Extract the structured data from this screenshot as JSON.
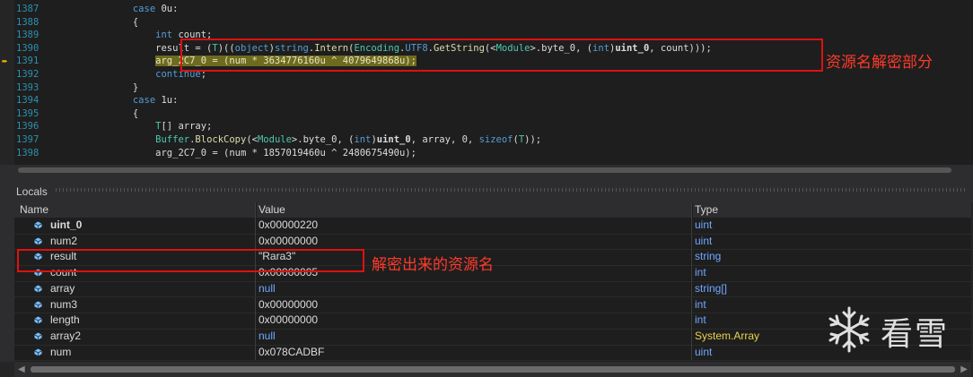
{
  "editor": {
    "lines": [
      {
        "num": "1387",
        "indent": "            ",
        "segments": [
          [
            "kw",
            "case "
          ],
          [
            "",
            "0u:"
          ]
        ]
      },
      {
        "num": "1388",
        "indent": "            ",
        "segments": [
          [
            "",
            "{"
          ]
        ]
      },
      {
        "num": "1389",
        "indent": "                ",
        "segments": [
          [
            "kw",
            "int "
          ],
          [
            "",
            "count;"
          ]
        ]
      },
      {
        "num": "1390",
        "indent": "                ",
        "segments": [
          [
            "",
            "result = ("
          ],
          [
            "ty",
            "T"
          ],
          [
            "",
            ")(("
          ],
          [
            "kw",
            "object"
          ],
          [
            "",
            ")"
          ],
          [
            "kw",
            "string"
          ],
          [
            "",
            "."
          ],
          [
            "mt",
            "Intern"
          ],
          [
            "",
            "("
          ],
          [
            "ty",
            "Encoding"
          ],
          [
            "",
            "."
          ],
          [
            "dim",
            "UTF8"
          ],
          [
            "",
            "."
          ],
          [
            "mt",
            "GetString"
          ],
          [
            "",
            "(<"
          ],
          [
            "ty",
            "Module"
          ],
          [
            "",
            ">.byte_0, ("
          ],
          [
            "kw",
            "int"
          ],
          [
            "",
            ")"
          ],
          [
            "bold",
            "uint_0"
          ],
          [
            "",
            ", count)));"
          ]
        ]
      },
      {
        "num": "1391",
        "indent": "                ",
        "segments": [
          [
            "hl",
            "arg_2C7_0 = (num * 3634776160u ^ 4079649868u);"
          ]
        ]
      },
      {
        "num": "1392",
        "indent": "                ",
        "segments": [
          [
            "kw",
            "continue"
          ],
          [
            "",
            ";"
          ]
        ]
      },
      {
        "num": "1393",
        "indent": "            ",
        "segments": [
          [
            "",
            "}"
          ]
        ]
      },
      {
        "num": "1394",
        "indent": "            ",
        "segments": [
          [
            "kw",
            "case "
          ],
          [
            "",
            "1u:"
          ]
        ]
      },
      {
        "num": "1395",
        "indent": "            ",
        "segments": [
          [
            "",
            "{"
          ]
        ]
      },
      {
        "num": "1396",
        "indent": "                ",
        "segments": [
          [
            "ty",
            "T"
          ],
          [
            "",
            "[] array;"
          ]
        ]
      },
      {
        "num": "1397",
        "indent": "                ",
        "segments": [
          [
            "ty",
            "Buffer"
          ],
          [
            "",
            "."
          ],
          [
            "mt",
            "BlockCopy"
          ],
          [
            "",
            "(<"
          ],
          [
            "ty",
            "Module"
          ],
          [
            "",
            ">.byte_0, ("
          ],
          [
            "kw",
            "int"
          ],
          [
            "",
            ")"
          ],
          [
            "bold",
            "uint_0"
          ],
          [
            "",
            ", array, 0, "
          ],
          [
            "kw",
            "sizeof"
          ],
          [
            "",
            "("
          ],
          [
            "ty",
            "T"
          ],
          [
            "",
            "));"
          ]
        ]
      },
      {
        "num": "1398",
        "indent": "                ",
        "segments": [
          [
            "",
            "arg_2C7_0 = (num * 1857019460u ^ 2480675490u);"
          ]
        ]
      }
    ]
  },
  "locals": {
    "title": "Locals",
    "headers": {
      "name": "Name",
      "value": "Value",
      "type": "Type"
    },
    "rows": [
      {
        "name": "uint_0",
        "value": "0x00000220",
        "type": "uint",
        "bold": true,
        "typeColor": "blue"
      },
      {
        "name": "num2",
        "value": "0x00000000",
        "type": "uint",
        "typeColor": "blue"
      },
      {
        "name": "result",
        "value": "\"Rara3\"",
        "type": "string",
        "typeColor": "blue"
      },
      {
        "name": "count",
        "value": "0x00000005",
        "type": "int",
        "typeColor": "blue"
      },
      {
        "name": "array",
        "value": "null",
        "type": "string[]",
        "valueColor": "blue",
        "typeColor": "blue"
      },
      {
        "name": "num3",
        "value": "0x00000000",
        "type": "int",
        "typeColor": "blue"
      },
      {
        "name": "length",
        "value": "0x00000000",
        "type": "int",
        "typeColor": "blue"
      },
      {
        "name": "array2",
        "value": "null",
        "type": "System.Array",
        "valueColor": "blue",
        "typeColor": "yellow"
      },
      {
        "name": "num",
        "value": "0x078CADBF",
        "type": "uint",
        "typeColor": "blue"
      }
    ]
  },
  "annotations": {
    "code_note": "资源名解密部分",
    "locals_note": "解密出来的资源名"
  },
  "watermark": {
    "text": "看雪"
  },
  "colors": {
    "accent_red": "#e01010",
    "line_numbers": "#2b91af",
    "current_line": "#6e6a1f"
  }
}
